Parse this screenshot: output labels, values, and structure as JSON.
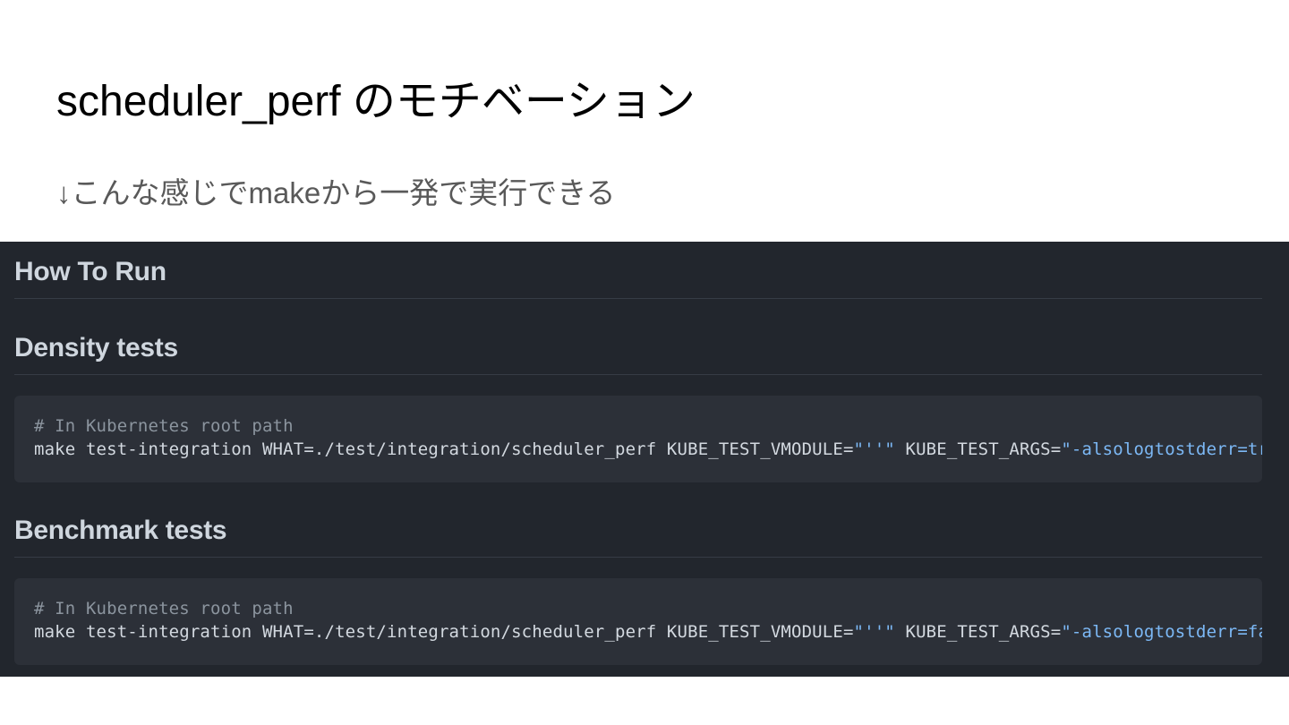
{
  "slide": {
    "title": "scheduler_perf のモチベーション",
    "subtitle": "↓こんな感じでmakeから一発で実行できる"
  },
  "screenshot": {
    "headings": {
      "how_to_run": "How To Run",
      "density_tests": "Density tests",
      "benchmark_tests": "Benchmark tests"
    },
    "density_code": {
      "comment": "# In Kubernetes root path",
      "command_prefix": "make test-integration WHAT=./test/integration/scheduler_perf KUBE_TEST_VMODULE=",
      "vmodule_value": "\"''\"",
      "args_label": " KUBE_TEST_ARGS=",
      "args_value": "\"-alsologtostderr=true"
    },
    "benchmark_code": {
      "comment": "# In Kubernetes root path",
      "command_prefix": "make test-integration WHAT=./test/integration/scheduler_perf KUBE_TEST_VMODULE=",
      "vmodule_value": "\"''\"",
      "args_label": " KUBE_TEST_ARGS=",
      "args_value": "\"-alsologtostderr=false"
    }
  },
  "colors": {
    "slide_background": "#ffffff",
    "title": "#000000",
    "subtitle": "#595959",
    "screenshot_background": "#22262d",
    "code_block_background": "#2c3038",
    "heading_text": "#cfd6de",
    "code_comment": "#8b949e",
    "code_text": "#d3d9e0",
    "code_string": "#7cb8f5"
  }
}
